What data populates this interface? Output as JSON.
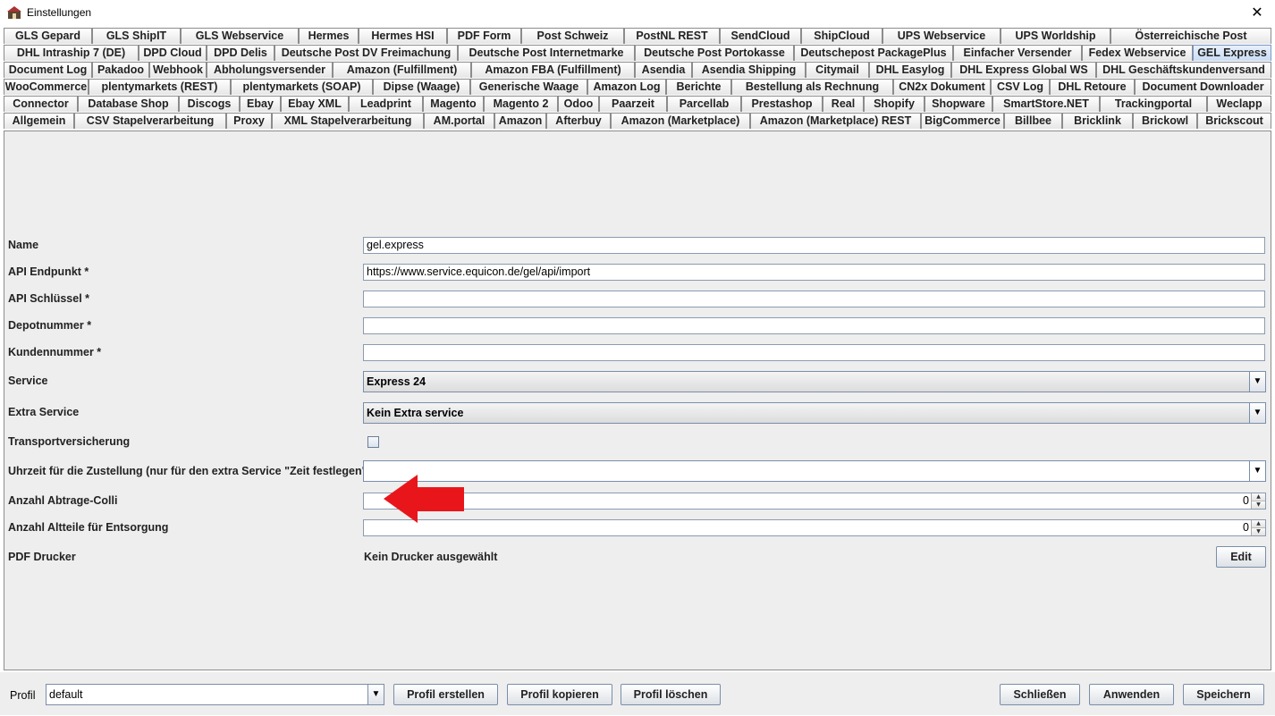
{
  "window": {
    "title": "Einstellungen",
    "close_glyph": "✕"
  },
  "tabs": {
    "row1": [
      "GLS Gepard",
      "GLS ShipIT",
      "GLS Webservice",
      "Hermes",
      "Hermes HSI",
      "PDF Form",
      "Post Schweiz",
      "PostNL REST",
      "SendCloud",
      "ShipCloud",
      "UPS Webservice",
      "UPS Worldship",
      "Österreichische Post"
    ],
    "row2": [
      "DHL Intraship 7 (DE)",
      "DPD Cloud",
      "DPD Delis",
      "Deutsche Post DV Freimachung",
      "Deutsche Post Internetmarke",
      "Deutsche Post Portokasse",
      "Deutschepost PackagePlus",
      "Einfacher Versender",
      "Fedex Webservice",
      "GEL Express"
    ],
    "row3": [
      "Document Log",
      "Pakadoo",
      "Webhook",
      "Abholungsversender",
      "Amazon (Fulfillment)",
      "Amazon FBA (Fulfillment)",
      "Asendia",
      "Asendia Shipping",
      "Citymail",
      "DHL Easylog",
      "DHL Express Global WS",
      "DHL Geschäftskundenversand"
    ],
    "row4": [
      "WooCommerce",
      "plentymarkets (REST)",
      "plentymarkets (SOAP)",
      "Dipse (Waage)",
      "Generische Waage",
      "Amazon Log",
      "Berichte",
      "Bestellung als Rechnung",
      "CN2x Dokument",
      "CSV Log",
      "DHL Retoure",
      "Document Downloader"
    ],
    "row5": [
      "Connector",
      "Database Shop",
      "Discogs",
      "Ebay",
      "Ebay XML",
      "Leadprint",
      "Magento",
      "Magento 2",
      "Odoo",
      "Paarzeit",
      "Parcellab",
      "Prestashop",
      "Real",
      "Shopify",
      "Shopware",
      "SmartStore.NET",
      "Trackingportal",
      "Weclapp"
    ],
    "row6": [
      "Allgemein",
      "CSV Stapelverarbeitung",
      "Proxy",
      "XML Stapelverarbeitung",
      "AM.portal",
      "Amazon",
      "Afterbuy",
      "Amazon (Marketplace)",
      "Amazon (Marketplace) REST",
      "BigCommerce",
      "Billbee",
      "Bricklink",
      "Brickowl",
      "Brickscout"
    ],
    "active": "GEL Express"
  },
  "form": {
    "name_label": "Name",
    "name_value": "gel.express",
    "api_endpoint_label": "API Endpunkt *",
    "api_endpoint_value": "https://www.service.equicon.de/gel/api/import",
    "api_key_label": "API Schlüssel *",
    "api_key_value": "",
    "depot_label": "Depotnummer *",
    "depot_value": "",
    "customer_label": "Kundennummer *",
    "customer_value": "",
    "service_label": "Service",
    "service_value": "Express 24",
    "extra_service_label": "Extra Service",
    "extra_service_value": "Kein Extra service",
    "insurance_label": "Transportversicherung",
    "insurance_checked": false,
    "time_label": "Uhrzeit für die Zustellung (nur für den extra Service \"Zeit festlegen\")",
    "time_value": "",
    "pickup_colli_label": "Anzahl Abtrage-Colli",
    "pickup_colli_value": "0",
    "old_parts_label": "Anzahl Altteile für Entsorgung",
    "old_parts_value": "0",
    "pdf_printer_label": "PDF Drucker",
    "pdf_printer_value": "Kein Drucker ausgewählt",
    "edit_label": "Edit"
  },
  "bottom": {
    "profile_label": "Profil",
    "profile_value": "default",
    "create_label": "Profil erstellen",
    "copy_label": "Profil kopieren",
    "delete_label": "Profil löschen",
    "close_label": "Schließen",
    "apply_label": "Anwenden",
    "save_label": "Speichern"
  },
  "colors": {
    "arrow": "#e8161b",
    "active_tab": "#c9dcf5"
  }
}
